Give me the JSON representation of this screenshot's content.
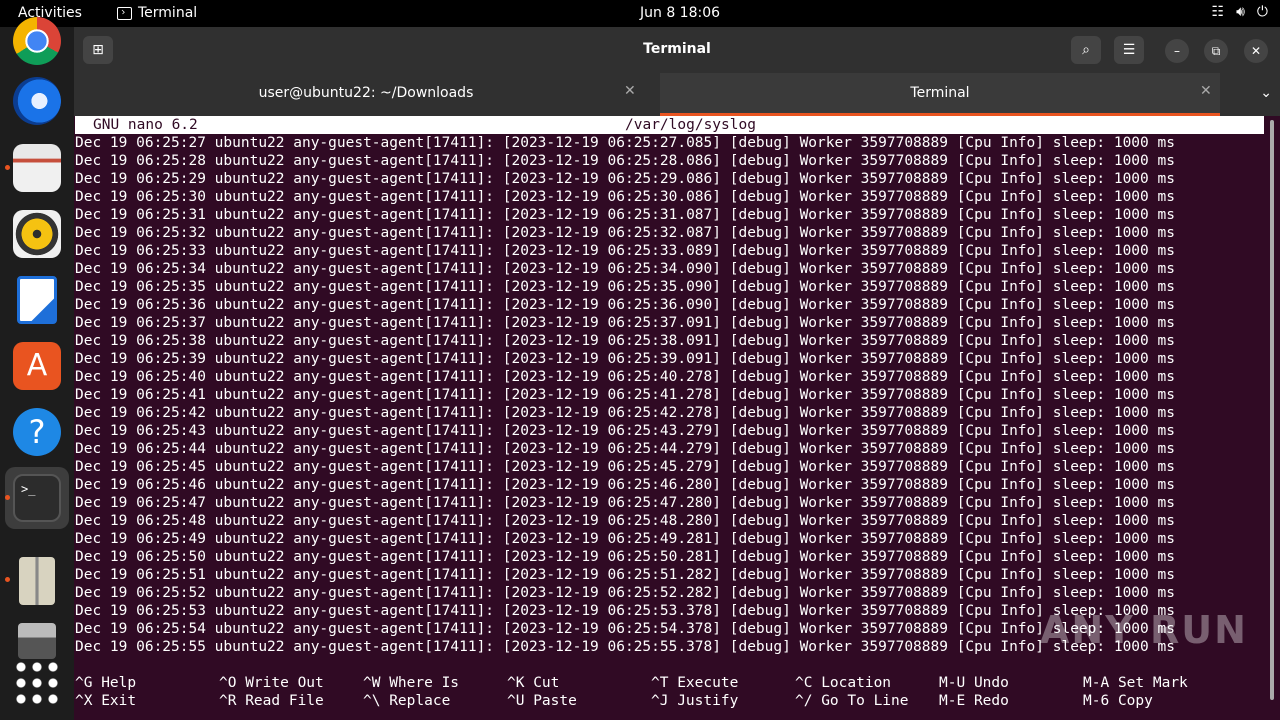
{
  "topbar": {
    "activities": "Activities",
    "app_name": "Terminal",
    "clock": "Jun 8  18:06"
  },
  "window": {
    "title": "Terminal",
    "tabs": [
      {
        "label": "user@ubuntu22: ~/Downloads",
        "active": false
      },
      {
        "label": "Terminal",
        "active": true
      }
    ]
  },
  "nano": {
    "version": "GNU nano 6.2",
    "filename": "/var/log/syslog",
    "lines": [
      "Dec 19 06:25:27 ubuntu22 any-guest-agent[17411]: [2023-12-19 06:25:27.085] [debug] Worker 3597708889 [Cpu Info] sleep: 1000 ms",
      "Dec 19 06:25:28 ubuntu22 any-guest-agent[17411]: [2023-12-19 06:25:28.086] [debug] Worker 3597708889 [Cpu Info] sleep: 1000 ms",
      "Dec 19 06:25:29 ubuntu22 any-guest-agent[17411]: [2023-12-19 06:25:29.086] [debug] Worker 3597708889 [Cpu Info] sleep: 1000 ms",
      "Dec 19 06:25:30 ubuntu22 any-guest-agent[17411]: [2023-12-19 06:25:30.086] [debug] Worker 3597708889 [Cpu Info] sleep: 1000 ms",
      "Dec 19 06:25:31 ubuntu22 any-guest-agent[17411]: [2023-12-19 06:25:31.087] [debug] Worker 3597708889 [Cpu Info] sleep: 1000 ms",
      "Dec 19 06:25:32 ubuntu22 any-guest-agent[17411]: [2023-12-19 06:25:32.087] [debug] Worker 3597708889 [Cpu Info] sleep: 1000 ms",
      "Dec 19 06:25:33 ubuntu22 any-guest-agent[17411]: [2023-12-19 06:25:33.089] [debug] Worker 3597708889 [Cpu Info] sleep: 1000 ms",
      "Dec 19 06:25:34 ubuntu22 any-guest-agent[17411]: [2023-12-19 06:25:34.090] [debug] Worker 3597708889 [Cpu Info] sleep: 1000 ms",
      "Dec 19 06:25:35 ubuntu22 any-guest-agent[17411]: [2023-12-19 06:25:35.090] [debug] Worker 3597708889 [Cpu Info] sleep: 1000 ms",
      "Dec 19 06:25:36 ubuntu22 any-guest-agent[17411]: [2023-12-19 06:25:36.090] [debug] Worker 3597708889 [Cpu Info] sleep: 1000 ms",
      "Dec 19 06:25:37 ubuntu22 any-guest-agent[17411]: [2023-12-19 06:25:37.091] [debug] Worker 3597708889 [Cpu Info] sleep: 1000 ms",
      "Dec 19 06:25:38 ubuntu22 any-guest-agent[17411]: [2023-12-19 06:25:38.091] [debug] Worker 3597708889 [Cpu Info] sleep: 1000 ms",
      "Dec 19 06:25:39 ubuntu22 any-guest-agent[17411]: [2023-12-19 06:25:39.091] [debug] Worker 3597708889 [Cpu Info] sleep: 1000 ms",
      "Dec 19 06:25:40 ubuntu22 any-guest-agent[17411]: [2023-12-19 06:25:40.278] [debug] Worker 3597708889 [Cpu Info] sleep: 1000 ms",
      "Dec 19 06:25:41 ubuntu22 any-guest-agent[17411]: [2023-12-19 06:25:41.278] [debug] Worker 3597708889 [Cpu Info] sleep: 1000 ms",
      "Dec 19 06:25:42 ubuntu22 any-guest-agent[17411]: [2023-12-19 06:25:42.278] [debug] Worker 3597708889 [Cpu Info] sleep: 1000 ms",
      "Dec 19 06:25:43 ubuntu22 any-guest-agent[17411]: [2023-12-19 06:25:43.279] [debug] Worker 3597708889 [Cpu Info] sleep: 1000 ms",
      "Dec 19 06:25:44 ubuntu22 any-guest-agent[17411]: [2023-12-19 06:25:44.279] [debug] Worker 3597708889 [Cpu Info] sleep: 1000 ms",
      "Dec 19 06:25:45 ubuntu22 any-guest-agent[17411]: [2023-12-19 06:25:45.279] [debug] Worker 3597708889 [Cpu Info] sleep: 1000 ms",
      "Dec 19 06:25:46 ubuntu22 any-guest-agent[17411]: [2023-12-19 06:25:46.280] [debug] Worker 3597708889 [Cpu Info] sleep: 1000 ms",
      "Dec 19 06:25:47 ubuntu22 any-guest-agent[17411]: [2023-12-19 06:25:47.280] [debug] Worker 3597708889 [Cpu Info] sleep: 1000 ms",
      "Dec 19 06:25:48 ubuntu22 any-guest-agent[17411]: [2023-12-19 06:25:48.280] [debug] Worker 3597708889 [Cpu Info] sleep: 1000 ms",
      "Dec 19 06:25:49 ubuntu22 any-guest-agent[17411]: [2023-12-19 06:25:49.281] [debug] Worker 3597708889 [Cpu Info] sleep: 1000 ms",
      "Dec 19 06:25:50 ubuntu22 any-guest-agent[17411]: [2023-12-19 06:25:50.281] [debug] Worker 3597708889 [Cpu Info] sleep: 1000 ms",
      "Dec 19 06:25:51 ubuntu22 any-guest-agent[17411]: [2023-12-19 06:25:51.282] [debug] Worker 3597708889 [Cpu Info] sleep: 1000 ms",
      "Dec 19 06:25:52 ubuntu22 any-guest-agent[17411]: [2023-12-19 06:25:52.282] [debug] Worker 3597708889 [Cpu Info] sleep: 1000 ms",
      "Dec 19 06:25:53 ubuntu22 any-guest-agent[17411]: [2023-12-19 06:25:53.378] [debug] Worker 3597708889 [Cpu Info] sleep: 1000 ms",
      "Dec 19 06:25:54 ubuntu22 any-guest-agent[17411]: [2023-12-19 06:25:54.378] [debug] Worker 3597708889 [Cpu Info] sleep: 1000 ms",
      "Dec 19 06:25:55 ubuntu22 any-guest-agent[17411]: [2023-12-19 06:25:55.378] [debug] Worker 3597708889 [Cpu Info] sleep: 1000 ms"
    ],
    "shortcuts": [
      [
        {
          "key": "^G",
          "label": "Help"
        },
        {
          "key": "^X",
          "label": "Exit"
        }
      ],
      [
        {
          "key": "^O",
          "label": "Write Out"
        },
        {
          "key": "^R",
          "label": "Read File"
        }
      ],
      [
        {
          "key": "^W",
          "label": "Where Is"
        },
        {
          "key": "^\\",
          "label": "Replace"
        }
      ],
      [
        {
          "key": "^K",
          "label": "Cut"
        },
        {
          "key": "^U",
          "label": "Paste"
        }
      ],
      [
        {
          "key": "^T",
          "label": "Execute"
        },
        {
          "key": "^J",
          "label": "Justify"
        }
      ],
      [
        {
          "key": "^C",
          "label": "Location"
        },
        {
          "key": "^/",
          "label": "Go To Line"
        }
      ],
      [
        {
          "key": "M-U",
          "label": "Undo"
        },
        {
          "key": "M-E",
          "label": "Redo"
        }
      ],
      [
        {
          "key": "M-A",
          "label": "Set Mark"
        },
        {
          "key": "M-6",
          "label": "Copy"
        }
      ]
    ]
  },
  "dock": {
    "items": [
      "chrome-icon",
      "thunderbird-icon",
      "files-icon",
      "rhythmbox-icon",
      "libreoffice-writer-icon",
      "app-center-icon",
      "help-icon",
      "terminal-icon",
      "archive-icon",
      "disk-icon",
      "show-apps-icon"
    ]
  },
  "watermark": "ANY RUN",
  "colors": {
    "accent": "#e95420",
    "terminal_bg": "#300a24"
  }
}
